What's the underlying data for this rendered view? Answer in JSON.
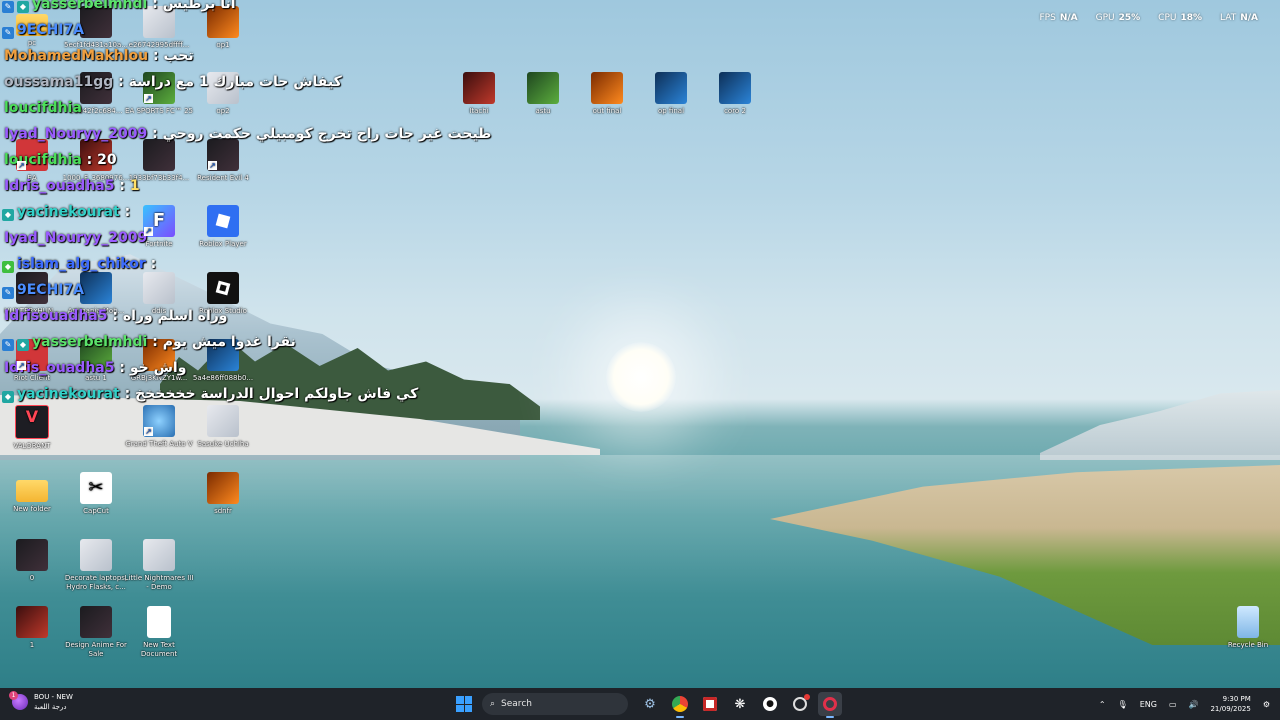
{
  "performance": [
    {
      "label": "FPS",
      "value": "N/A"
    },
    {
      "label": "GPU",
      "value": "25%"
    },
    {
      "label": "CPU",
      "value": "18%"
    },
    {
      "label": "LAT",
      "value": "N/A"
    }
  ],
  "desktop_icons": [
    {
      "label": "pc"
    },
    {
      "label": "5ecf1fd431a10a..."
    },
    {
      "label": "e26742995dffff..."
    },
    {
      "label": "op1"
    },
    {
      "label": "Itachi"
    },
    {
      "label": "astu"
    },
    {
      "label": "out final"
    },
    {
      "label": "op final"
    },
    {
      "label": "coro 2"
    },
    {
      "label": "Recycle Bin"
    },
    {
      "label": "11a42f2c684..."
    },
    {
      "label": "EA SPORTS FC™ 25"
    },
    {
      "label": "op2"
    },
    {
      "label": "EA"
    },
    {
      "label": "1000_F_3680976..."
    },
    {
      "label": "1933bf73b33f4..."
    },
    {
      "label": "Resident Evil 4"
    },
    {
      "label": "Fortnite"
    },
    {
      "label": "Roblox Player"
    },
    {
      "label": "HUNTERxHUN..."
    },
    {
      "label": "Animania Mob..."
    },
    {
      "label": "ddis"
    },
    {
      "label": "Roblox Studio"
    },
    {
      "label": "Riot Client"
    },
    {
      "label": "astu 1"
    },
    {
      "label": "GRBj3KNZY1w..."
    },
    {
      "label": "5a4e86ff088b0..."
    },
    {
      "label": "VALORANT"
    },
    {
      "label": "Grand Theft Auto V"
    },
    {
      "label": "Sasuke Uchiha"
    },
    {
      "label": "New folder"
    },
    {
      "label": "CapCut"
    },
    {
      "label": "sdnfr"
    },
    {
      "label": "0"
    },
    {
      "label": "Decorate laptops, Hydro Flasks, c..."
    },
    {
      "label": "Little Nightmares III - Demo"
    },
    {
      "label": "1"
    },
    {
      "label": "Design Anime For Sale"
    },
    {
      "label": "New Text Document"
    }
  ],
  "chat": [
    {
      "user": "yasserbelmhdi",
      "text": "أنا برطيس",
      "color": "#5be36b"
    },
    {
      "user": "9ECHI7A",
      "text": "",
      "color": "#4b8dff"
    },
    {
      "user": "MohamedMakhlou",
      "text": "تحب",
      "color": "#f0a040"
    },
    {
      "user": "oussama11gg",
      "text": "كيفاش جات مبارك 1 مع دراسة",
      "color": "#b0b7c3"
    },
    {
      "user": "loucifdhia",
      "text": "",
      "color": "#4cdf5a"
    },
    {
      "user": "Iyad_Nouryy_2009",
      "text": "طيحت غير جات راح تخرج كومبيلي حكمت روحي",
      "color": "#9a5cff"
    },
    {
      "user": "loucifdhia",
      "text": "20",
      "color": "#4cdf5a"
    },
    {
      "user": "Idris_ouadha5",
      "text": "1",
      "color": "#9a5cff"
    },
    {
      "user": "yacinekourat",
      "text": "",
      "color": "#33d1c8"
    },
    {
      "user": "Iyad_Nouryy_2009",
      "text": "",
      "color": "#9a5cff"
    },
    {
      "user": "islam_alg_chikor",
      "text": "",
      "color": "#3d6cff"
    },
    {
      "user": "9ECHI7A",
      "text": "",
      "color": "#4b8dff"
    },
    {
      "user": "Idrisouadha5",
      "text": "وراه اسلم وراه",
      "color": "#9a5cff"
    },
    {
      "user": "yasserbelmhdi",
      "text": "نقرا غدوا ميش يوم",
      "color": "#5be36b"
    },
    {
      "user": "Idris_ouadha5",
      "text": "واش خو",
      "color": "#9a5cff"
    },
    {
      "user": "yacinekourat",
      "text": "كي فاش جاولكم احوال الدراسة خخخخخخ",
      "color": "#33d1c8"
    }
  ],
  "taskbar": {
    "weather_title": "BOU - NEW",
    "weather_sub": "درجة اللعبة",
    "weather_badge": "1",
    "search_placeholder": "Search",
    "language": "ENG",
    "time": "9:30 PM",
    "date": "21/09/2025"
  }
}
